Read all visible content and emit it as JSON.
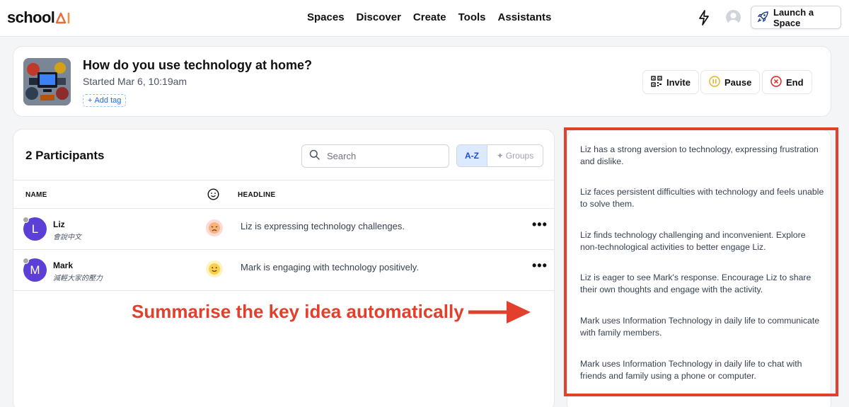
{
  "nav": {
    "logo_text": "school",
    "links": [
      "Spaces",
      "Discover",
      "Create",
      "Tools",
      "Assistants"
    ],
    "launch_label": "Launch a Space",
    "colors": {
      "accent": "#2563eb",
      "logo_ai": "#e66a3a"
    }
  },
  "space": {
    "title": "How do you use technology at home?",
    "started": "Started Mar 6, 10:19am",
    "add_tag": "Add tag",
    "invite": "Invite",
    "pause": "Pause",
    "end": "End"
  },
  "participants": {
    "title": "2 Participants",
    "search_placeholder": "Search",
    "sort_az": "A-Z",
    "groups": "Groups",
    "col_name": "NAME",
    "col_headline": "HEADLINE",
    "rows": [
      {
        "initial": "L",
        "name": "Liz",
        "subtitle": "會說中文",
        "mood": "sad",
        "headline": "Liz is expressing technology challenges."
      },
      {
        "initial": "M",
        "name": "Mark",
        "subtitle": "減輕大家的壓力",
        "mood": "happy",
        "headline": "Mark is engaging with technology positively."
      }
    ]
  },
  "annotation": {
    "text": "Summarise the key idea automatically",
    "color": "#e2402c"
  },
  "summary": {
    "items": [
      "Liz has a strong aversion to technology, expressing frustration and dislike.",
      "Liz faces persistent difficulties with technology and feels unable to solve them.",
      "Liz finds technology challenging and inconvenient. Explore non-technological activities to better engage Liz.",
      "Liz is eager to see Mark's response. Encourage Liz to share their own thoughts and engage with the activity.",
      "Mark uses Information Technology in daily life to communicate with family members.",
      "Mark uses Information Technology in daily life to chat with friends and family using a phone or computer."
    ]
  }
}
